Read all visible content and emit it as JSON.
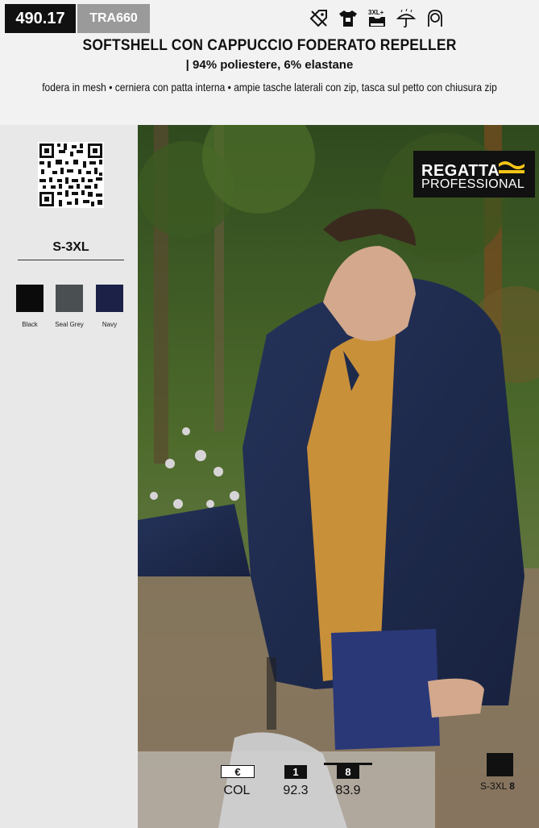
{
  "header": {
    "code": "490.17",
    "sku": "TRA660",
    "title": "SOFTSHELL CON CAPPUCCIO FODERATO REPELLER",
    "material": "| 94% poliestere, 6% elastane",
    "features": "fodera in mesh • cerniera con patta interna • ampie tasche laterali con zip, tasca sul petto con chiusura zip",
    "feature_icons": [
      "no-discount-icon",
      "tshirt-print-icon",
      "size-3xl-plus-icon",
      "waterproof-umbrella-icon",
      "hood-icon"
    ],
    "size_icon_text": "3XL+"
  },
  "sidebar": {
    "sizes": "S-3XL",
    "colors": [
      {
        "name": "Black",
        "hex": "#0b0b0b"
      },
      {
        "name": "Seal Grey",
        "hex": "#4a4f52"
      },
      {
        "name": "Navy",
        "hex": "#1c2147"
      }
    ]
  },
  "brand": {
    "line1": "REGATTA",
    "line2": "PROFESSIONAL",
    "accent": "#f5c518"
  },
  "pricing": {
    "currency_symbol": "€",
    "col_label": "COL",
    "tiers": [
      {
        "qty": "1",
        "price": "92.3"
      },
      {
        "qty": "8",
        "price": "83.9"
      }
    ]
  },
  "carton": {
    "size": "S-3XL",
    "qty": "8"
  }
}
